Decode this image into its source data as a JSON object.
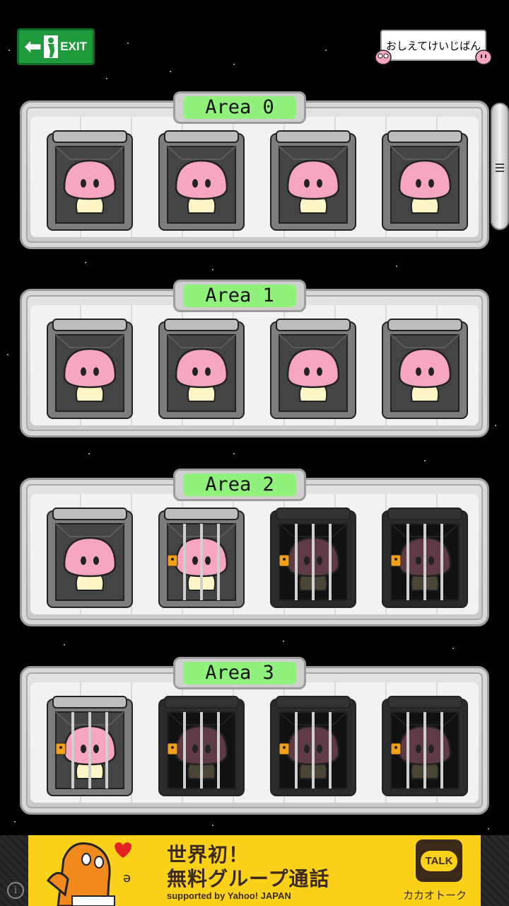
{
  "header": {
    "exit_label": "EXIT",
    "board_label": "おしえてけいじばん"
  },
  "areas": [
    {
      "label": "Area 0",
      "cells": [
        "free",
        "free",
        "free",
        "free"
      ]
    },
    {
      "label": "Area 1",
      "cells": [
        "free",
        "free",
        "free",
        "free"
      ]
    },
    {
      "label": "Area 2",
      "cells": [
        "free",
        "caged",
        "locked",
        "locked"
      ]
    },
    {
      "label": "Area 3",
      "cells": [
        "caged",
        "locked",
        "locked",
        "locked"
      ]
    }
  ],
  "ad": {
    "line1": "世界初！",
    "line2": "無料グループ通話",
    "line3": "supported by Yahoo! JAPAN",
    "talk_badge": "TALK",
    "brand": "カカオトーク"
  },
  "colors": {
    "label_green": "#90f27c",
    "character_pink": "#f6a6c0",
    "exit_green": "#1f9a3c",
    "ad_yellow": "#fcd11a"
  }
}
